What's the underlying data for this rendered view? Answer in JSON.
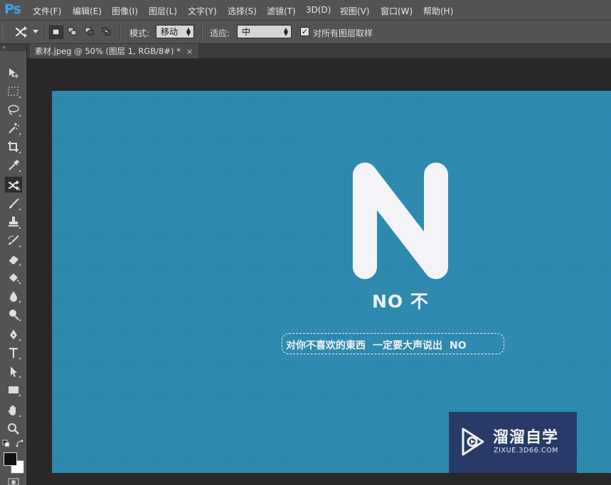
{
  "app": {
    "logo": "Ps"
  },
  "menu": [
    "文件(F)",
    "编辑(E)",
    "图像(I)",
    "图层(L)",
    "文字(Y)",
    "选择(S)",
    "滤镜(T)",
    "3D(D)",
    "视图(V)",
    "窗口(W)",
    "帮助(H)"
  ],
  "options": {
    "mode_label": "模式:",
    "mode_value": "移动",
    "adapt_label": "适应:",
    "adapt_value": "中",
    "sample_all_label": "对所有图层取样",
    "sample_all_checked": true
  },
  "document": {
    "tab_title": "素材.jpeg @ 50% (图层 1, RGB/8#) *",
    "close_symbol": "×"
  },
  "artwork": {
    "big_letter": "N",
    "no_line": "NO 不",
    "slogan_parts": [
      "对你不喜欢的東西",
      "一定要大声说出",
      "NO"
    ],
    "background_color": "#2c8ab0"
  },
  "watermark": {
    "title": "溜溜自学",
    "subtitle": "ZIXUE.3D66.COM"
  },
  "colors": {
    "foreground": "#111111",
    "background": "#ffffff",
    "accent": "#38a5f0"
  },
  "tools": [
    "move-tool",
    "marquee-tool",
    "lasso-tool",
    "magic-wand-tool",
    "crop-tool",
    "eyedropper-tool",
    "content-aware-move-tool",
    "brush-tool",
    "clone-stamp-tool",
    "history-brush-tool",
    "eraser-tool",
    "paint-bucket-tool",
    "blur-tool",
    "dodge-tool",
    "pen-tool",
    "type-tool",
    "path-selection-tool",
    "rectangle-tool",
    "hand-tool",
    "zoom-tool"
  ]
}
